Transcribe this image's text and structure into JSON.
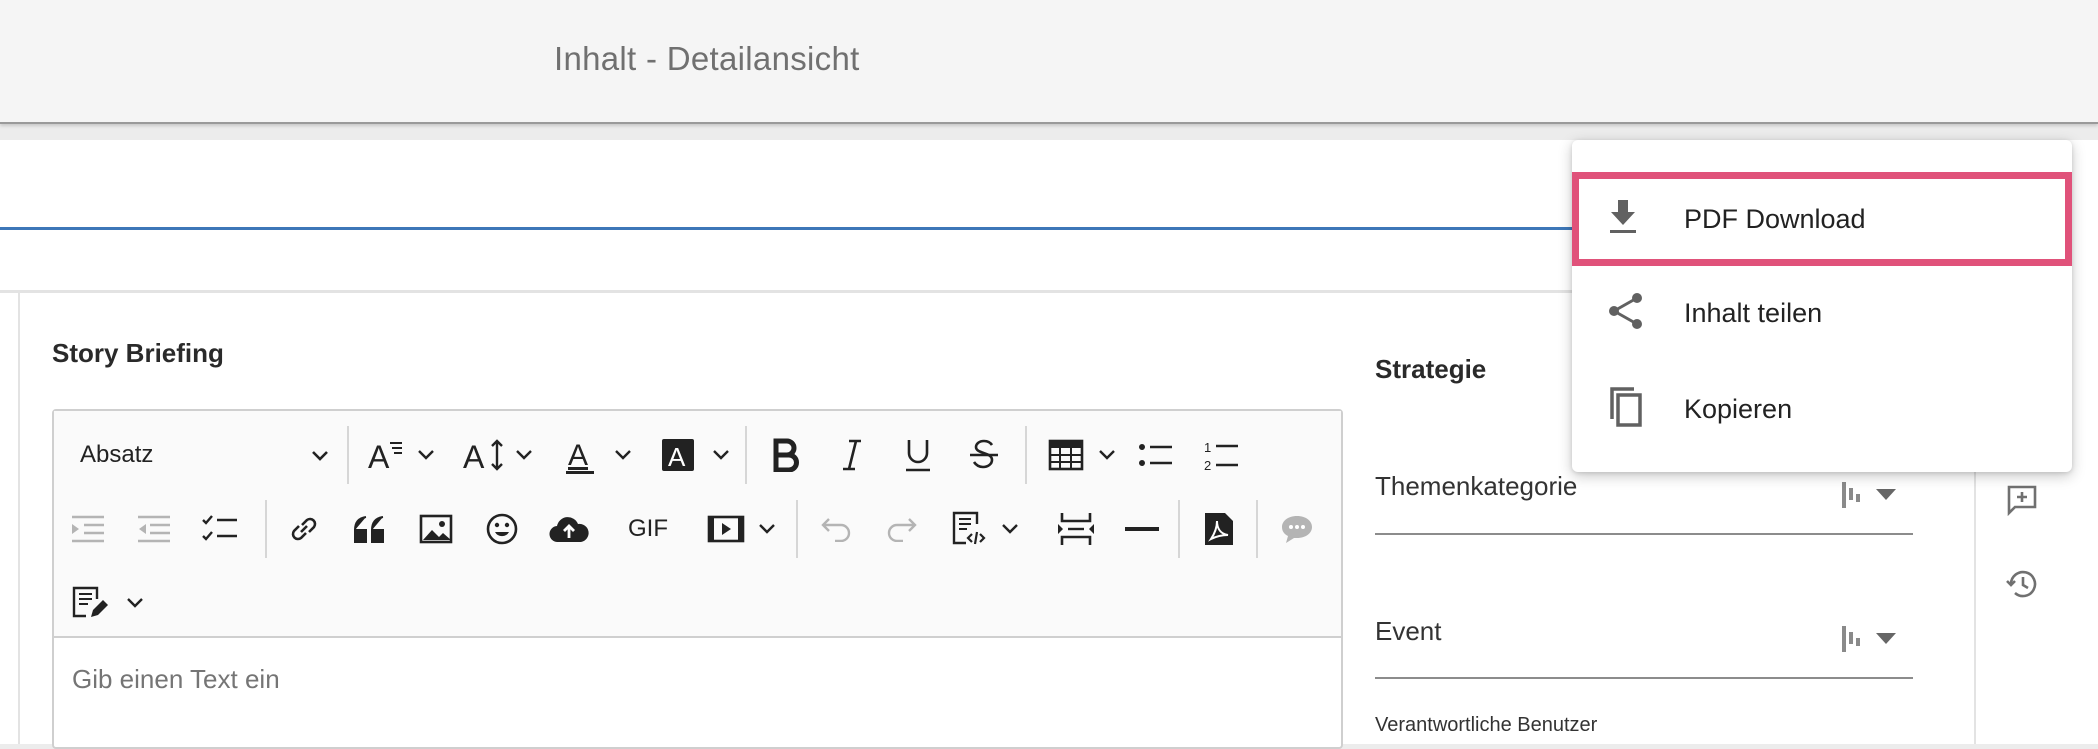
{
  "header": {
    "title": "Inhalt - Detailansicht"
  },
  "story_briefing": {
    "title": "Story Briefing",
    "paragraph_select": "Absatz",
    "placeholder": "Gib einen Text ein",
    "toolbar": {
      "gif_label": "GIF",
      "icons": [
        "font-style-icon",
        "font-size-icon",
        "font-color-icon",
        "font-background-color-icon",
        "bold-icon",
        "italic-icon",
        "underline-icon",
        "strikethrough-icon",
        "table-icon",
        "bulleted-list-icon",
        "numbered-list-icon",
        "outdent-icon",
        "indent-icon",
        "todo-list-icon",
        "link-icon",
        "blockquote-icon",
        "image-icon",
        "emoji-icon",
        "upload-icon",
        "gif-icon",
        "media-embed-icon",
        "undo-icon",
        "redo-icon",
        "source-editing-icon",
        "page-break-icon",
        "horizontal-line-icon",
        "pdf-icon",
        "comment-icon",
        "text-part-icon"
      ]
    }
  },
  "strategy": {
    "title": "Strategie",
    "fields": [
      {
        "label": "Themenkategorie"
      },
      {
        "label": "Event"
      }
    ],
    "responsible_users_label": "Verantwortliche Benutzer"
  },
  "context_menu": {
    "items": [
      {
        "label": "PDF Download",
        "icon": "download-icon",
        "highlighted": true
      },
      {
        "label": "Inhalt teilen",
        "icon": "share-icon",
        "highlighted": false
      },
      {
        "label": "Kopieren",
        "icon": "copy-icon",
        "highlighted": false
      }
    ],
    "highlight_color": "#e0527a"
  },
  "side_toolbar": {
    "icons": [
      "add-comment-icon",
      "history-icon"
    ]
  },
  "colors": {
    "accent_line": "#3d77b8"
  }
}
